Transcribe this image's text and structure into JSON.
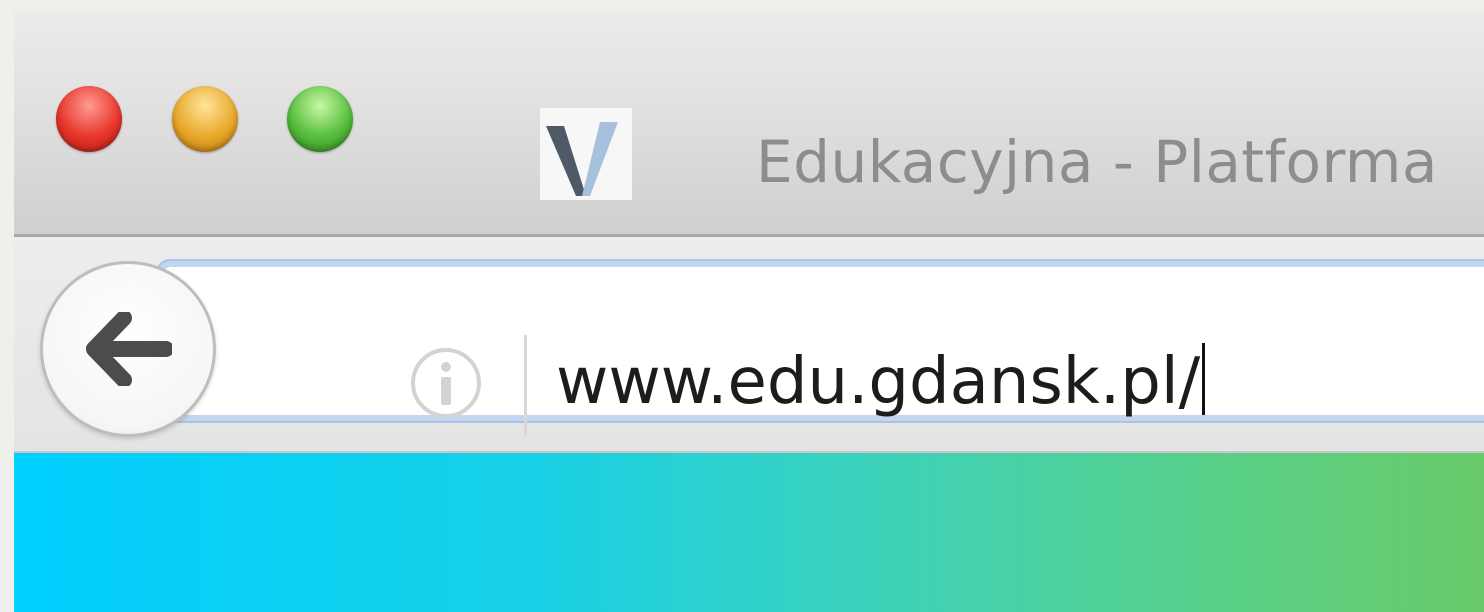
{
  "window": {
    "tab_title": "Edukacyjna - Platforma",
    "favicon": {
      "icon": "v-logo-icon",
      "letter": "V",
      "colors": [
        "#4f5a68",
        "#a7c1dc"
      ]
    },
    "traffic_lights": {
      "close_color": "#e8362b",
      "minimize_color": "#e9a82a",
      "zoom_color": "#56be3c"
    }
  },
  "toolbar": {
    "back_icon": "back-arrow-icon",
    "info_icon": "info-icon",
    "url_value": "www.edu.gdansk.pl/",
    "focus_ring_color": "#a9c4e6"
  },
  "content": {
    "gradient_colors": [
      "#00cfff",
      "#3fd2b8",
      "#6acb6a"
    ]
  }
}
